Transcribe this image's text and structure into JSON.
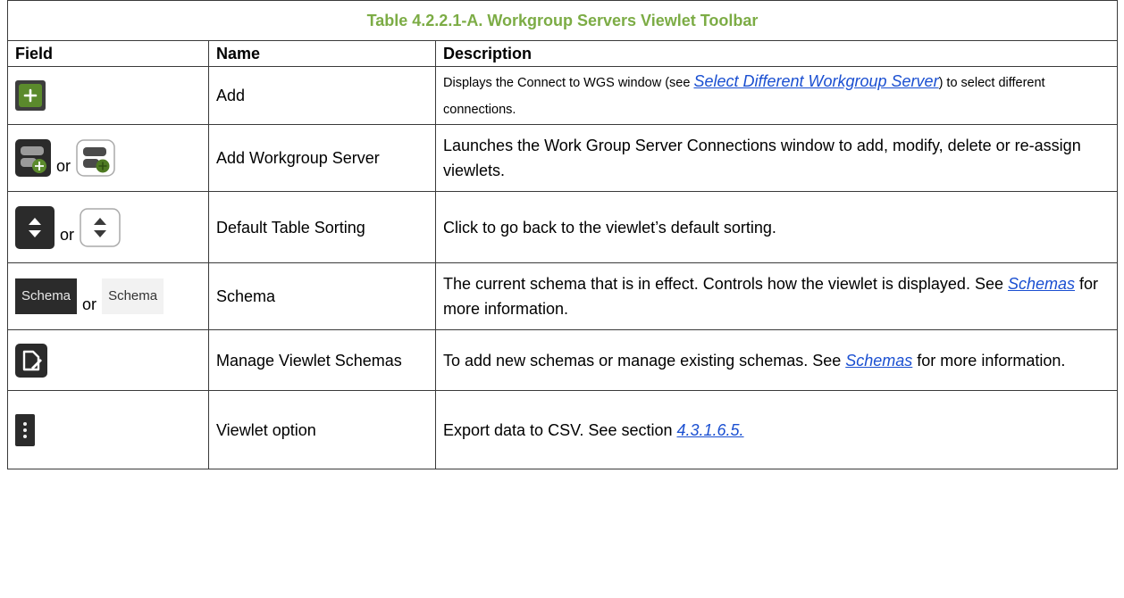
{
  "table": {
    "title": "Table 4.2.2.1-A.  Workgroup Servers Viewlet Toolbar",
    "headers": {
      "field": "Field",
      "name": "Name",
      "description": "Description"
    },
    "or_text": "or",
    "rows": [
      {
        "name": "Add",
        "icon": "plus-icon",
        "desc_before": "Displays the Connect to WGS window (see ",
        "link": "Select Different Workgroup Server",
        "desc_after": ") to select different connections."
      },
      {
        "name": "Add Workgroup Server",
        "icon": "add-server-icon",
        "desc": "Launches the Work Group Server Connections window to add, modify, delete or re-assign viewlets."
      },
      {
        "name": "Default Table Sorting",
        "icon": "sort-icon",
        "desc": "Click to go back to the viewlet’s default sorting."
      },
      {
        "name": "Schema",
        "chip_label": "Schema",
        "desc_before": "The current schema that is in effect. Controls how the viewlet is displayed.  See ",
        "link": "Schemas",
        "desc_after": " for more information."
      },
      {
        "name": "Manage Viewlet Schemas",
        "icon": "edit-document-icon",
        "desc_before": "To add new schemas or manage existing schemas. See ",
        "link": "Schemas",
        "desc_after": " for more information."
      },
      {
        "name": "Viewlet option",
        "icon": "more-vertical-icon",
        "desc_before": "Export data to CSV. See section ",
        "link": "4.3.1.6.5."
      }
    ]
  },
  "colors": {
    "title": "#7cac45",
    "link": "#1a4fd1",
    "icon_dark": "#2b2b2b",
    "icon_green": "#5b8a2c"
  }
}
